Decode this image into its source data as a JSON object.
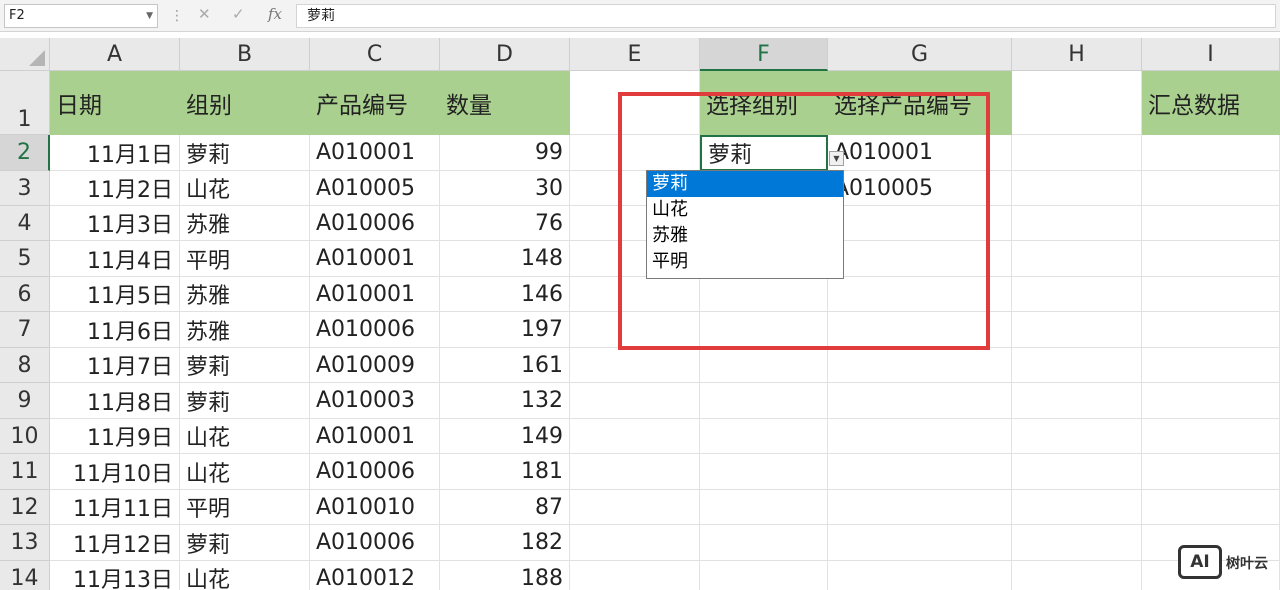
{
  "formula_bar": {
    "name_box": "F2",
    "cancel_icon": "cancel-icon",
    "confirm_icon": "checkmark-icon",
    "fx_label": "fx",
    "formula": "萝莉"
  },
  "columns": [
    "A",
    "B",
    "C",
    "D",
    "E",
    "F",
    "G",
    "H",
    "I"
  ],
  "selected_column": "F",
  "selected_row": "2",
  "rows": [
    "1",
    "2",
    "3",
    "4",
    "5",
    "6",
    "7",
    "8",
    "9",
    "10",
    "11",
    "12",
    "13",
    "14"
  ],
  "headers": {
    "A": "日期",
    "B": "组别",
    "C": "产品编号",
    "D": "数量",
    "F": "选择组别",
    "G": "选择产品编号",
    "I": "汇总数据"
  },
  "table": [
    [
      "11月1日",
      "萝莉",
      "A010001",
      "99"
    ],
    [
      "11月2日",
      "山花",
      "A010005",
      "30"
    ],
    [
      "11月3日",
      "苏雅",
      "A010006",
      "76"
    ],
    [
      "11月4日",
      "平明",
      "A010001",
      "148"
    ],
    [
      "11月5日",
      "苏雅",
      "A010001",
      "146"
    ],
    [
      "11月6日",
      "苏雅",
      "A010006",
      "197"
    ],
    [
      "11月7日",
      "萝莉",
      "A010009",
      "161"
    ],
    [
      "11月8日",
      "萝莉",
      "A010003",
      "132"
    ],
    [
      "11月9日",
      "山花",
      "A010001",
      "149"
    ],
    [
      "11月10日",
      "山花",
      "A010006",
      "181"
    ],
    [
      "11月11日",
      "平明",
      "A010010",
      "87"
    ],
    [
      "11月12日",
      "萝莉",
      "A010006",
      "182"
    ],
    [
      "11月13日",
      "山花",
      "A010012",
      "188"
    ]
  ],
  "selection": {
    "F2": "萝莉",
    "G2": "A010001",
    "G3": "A010005"
  },
  "dropdown": {
    "options": [
      "萝莉",
      "山花",
      "苏雅",
      "平明"
    ],
    "highlighted": "萝莉"
  },
  "colors": {
    "header_fill": "#a9d08e",
    "highlight_box": "#e03c3c",
    "selection_accent": "#217346",
    "dropdown_highlight": "#0078d7"
  },
  "watermark": {
    "logo_text": "AI",
    "name": "树叶云"
  }
}
